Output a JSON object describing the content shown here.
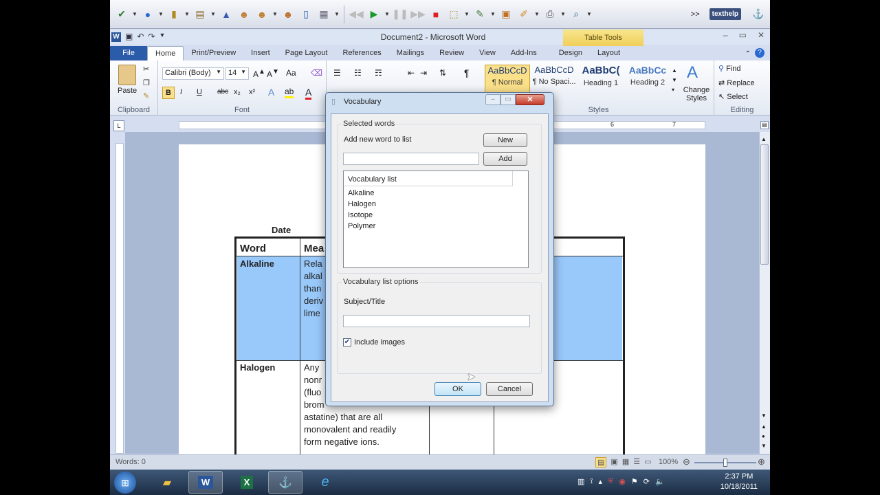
{
  "window": {
    "title": "Document2 - Microsoft Word",
    "context_tab": "Table Tools"
  },
  "texthelp": {
    "logo": "texthelp",
    "more": ">>"
  },
  "tabs": [
    "File",
    "Home",
    "Print/Preview",
    "Insert",
    "Page Layout",
    "References",
    "Mailings",
    "Review",
    "View",
    "Add-Ins",
    "Design",
    "Layout"
  ],
  "active_tab": "Home",
  "ribbon": {
    "clipboard": {
      "paste": "Paste",
      "label": "Clipboard"
    },
    "font": {
      "name": "Calibri (Body)",
      "size": "14",
      "label": "Font",
      "bold": "B",
      "italic": "I",
      "underline": "U",
      "strike": "abc",
      "sub": "x₂",
      "sup": "x²"
    },
    "paragraph": {
      "pilcrow": "¶"
    },
    "styles": {
      "label": "Styles",
      "items": [
        {
          "sample": "AaBbCcD",
          "name": "¶ Normal"
        },
        {
          "sample": "AaBbCcD",
          "name": "¶ No Spaci..."
        },
        {
          "sample": "AaBbC(",
          "name": "Heading 1"
        },
        {
          "sample": "AaBbCc",
          "name": "Heading 2"
        }
      ],
      "change_styles": "Change Styles"
    },
    "editing": {
      "label": "Editing",
      "find": "Find",
      "replace": "Replace",
      "select": "Select"
    }
  },
  "ruler": {
    "marks": [
      "6",
      "7"
    ]
  },
  "document": {
    "date_label": "Date",
    "table": {
      "headers": [
        "Word",
        "Mea"
      ],
      "rows": [
        {
          "word": "Alkaline",
          "lines": [
            "Rela",
            "alkal",
            "than",
            "deriv",
            "lime"
          ]
        },
        {
          "word": "Halogen",
          "lines": [
            "Any",
            "nonr",
            "(fluo",
            "brom",
            "astatine) that are all",
            "monovalent and readily",
            "form negative ions."
          ]
        }
      ]
    }
  },
  "dialog": {
    "title": "Vocabulary",
    "selected_words_legend": "Selected words",
    "add_new_label": "Add new word to list",
    "new_button": "New",
    "add_button": "Add",
    "list_header": "Vocabulary list",
    "list_items": [
      "Alkaline",
      "Halogen",
      "Isotope",
      "Polymer"
    ],
    "options_legend": "Vocabulary list options",
    "subject_label": "Subject/Title",
    "subject_value": "",
    "include_images_label": "Include images",
    "include_images_checked": true,
    "ok_button": "OK",
    "cancel_button": "Cancel"
  },
  "status": {
    "words": "Words: 0",
    "zoom": "100%"
  },
  "taskbar": {
    "time": "2:37 PM",
    "date": "10/18/2011"
  }
}
